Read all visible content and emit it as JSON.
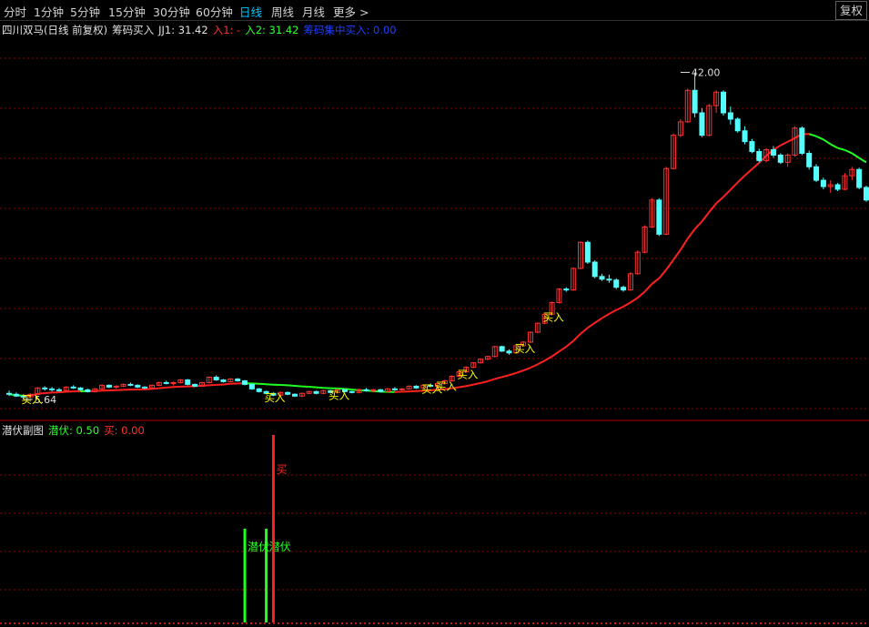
{
  "toolbar": {
    "timeframes": [
      "分时",
      "1分钟",
      "5分钟",
      "15分钟",
      "30分钟",
      "60分钟",
      "日线",
      "周线",
      "月线",
      "更多 >"
    ],
    "active": "日线",
    "fq_label": "复权"
  },
  "main_panel": {
    "stock_title": "四川双马(日线 前复权)",
    "indicator_name": "筹码买入",
    "jj1": "JJ1: 31.42",
    "in1": "入1: -",
    "in2": "入2: 31.42",
    "chip": "筹码集中买入: 0.00"
  },
  "sub_panel": {
    "title": "潜伏副图",
    "qianfu": "潜伏: 0.50",
    "mai": "买: 0.00"
  },
  "colors": {
    "up": "#ff3232",
    "down": "#54ffff",
    "ma_up": "#ff2020",
    "ma_down": "#20ff20",
    "signal_text": "#ffff00",
    "grid": "#8b0000",
    "active_tab": "#00c8ff"
  },
  "chart_data": [
    {
      "type": "candlestick",
      "name": "main",
      "ylim": [
        4.0,
        46.0
      ],
      "max_label": "42.00",
      "min_label": "5.64",
      "max_index": 94,
      "min_index": 2,
      "candles": [
        [
          6.3,
          6.6,
          6.0,
          6.2
        ],
        [
          6.2,
          6.4,
          5.9,
          6.0
        ],
        [
          6.0,
          6.2,
          5.64,
          5.9
        ],
        [
          5.9,
          6.3,
          5.8,
          6.2
        ],
        [
          6.2,
          7.0,
          6.1,
          6.9
        ],
        [
          6.9,
          7.1,
          6.6,
          6.8
        ],
        [
          6.8,
          7.0,
          6.5,
          6.7
        ],
        [
          6.7,
          6.9,
          6.5,
          6.6
        ],
        [
          6.6,
          7.1,
          6.5,
          7.0
        ],
        [
          7.0,
          7.2,
          6.8,
          6.9
        ],
        [
          6.9,
          7.0,
          6.6,
          6.7
        ],
        [
          6.7,
          6.8,
          6.4,
          6.5
        ],
        [
          6.5,
          6.9,
          6.4,
          6.8
        ],
        [
          6.8,
          7.3,
          6.7,
          7.2
        ],
        [
          7.2,
          7.3,
          6.9,
          7.0
        ],
        [
          7.0,
          7.2,
          6.8,
          7.1
        ],
        [
          7.1,
          7.4,
          7.0,
          7.3
        ],
        [
          7.3,
          7.5,
          7.1,
          7.2
        ],
        [
          7.2,
          7.3,
          6.9,
          7.0
        ],
        [
          7.0,
          7.1,
          6.8,
          6.9
        ],
        [
          6.9,
          7.3,
          6.8,
          7.2
        ],
        [
          7.2,
          7.6,
          7.1,
          7.5
        ],
        [
          7.5,
          7.7,
          7.3,
          7.4
        ],
        [
          7.4,
          7.6,
          7.2,
          7.5
        ],
        [
          7.5,
          7.9,
          7.4,
          7.8
        ],
        [
          7.8,
          7.9,
          7.2,
          7.3
        ],
        [
          7.3,
          7.4,
          7.0,
          7.1
        ],
        [
          7.1,
          7.6,
          7.0,
          7.5
        ],
        [
          7.5,
          8.2,
          7.4,
          8.1
        ],
        [
          8.1,
          8.3,
          7.7,
          7.8
        ],
        [
          7.8,
          7.9,
          7.5,
          7.6
        ],
        [
          7.6,
          8.0,
          7.5,
          7.9
        ],
        [
          7.9,
          8.0,
          7.6,
          7.7
        ],
        [
          7.7,
          7.8,
          7.2,
          7.3
        ],
        [
          7.3,
          7.4,
          6.7,
          6.8
        ],
        [
          6.8,
          6.9,
          6.4,
          6.5
        ],
        [
          6.5,
          6.6,
          6.2,
          6.3
        ],
        [
          6.3,
          6.4,
          6.0,
          6.1
        ],
        [
          6.1,
          6.5,
          6.0,
          6.4
        ],
        [
          6.4,
          6.5,
          6.1,
          6.2
        ],
        [
          6.2,
          6.3,
          5.9,
          6.0
        ],
        [
          6.0,
          6.4,
          5.9,
          6.3
        ],
        [
          6.3,
          6.6,
          6.2,
          6.5
        ],
        [
          6.5,
          6.6,
          6.2,
          6.3
        ],
        [
          6.3,
          6.7,
          6.2,
          6.6
        ],
        [
          6.6,
          6.7,
          6.3,
          6.4
        ],
        [
          6.4,
          6.8,
          6.3,
          6.7
        ],
        [
          6.7,
          6.8,
          6.4,
          6.5
        ],
        [
          6.5,
          6.6,
          6.3,
          6.4
        ],
        [
          6.4,
          6.8,
          6.3,
          6.7
        ],
        [
          6.7,
          6.9,
          6.5,
          6.6
        ],
        [
          6.6,
          6.8,
          6.4,
          6.7
        ],
        [
          6.7,
          6.8,
          6.4,
          6.5
        ],
        [
          6.5,
          6.9,
          6.4,
          6.8
        ],
        [
          6.8,
          7.0,
          6.6,
          6.7
        ],
        [
          6.7,
          6.9,
          6.5,
          6.8
        ],
        [
          6.8,
          7.2,
          6.7,
          7.1
        ],
        [
          7.1,
          7.2,
          6.8,
          6.9
        ],
        [
          6.9,
          7.3,
          6.8,
          7.2
        ],
        [
          7.2,
          7.4,
          7.0,
          7.1
        ],
        [
          7.1,
          7.5,
          7.0,
          7.4
        ],
        [
          7.4,
          7.8,
          7.3,
          7.7
        ],
        [
          7.7,
          8.3,
          7.6,
          8.2
        ],
        [
          8.2,
          8.8,
          8.1,
          8.7
        ],
        [
          8.7,
          9.3,
          8.6,
          9.2
        ],
        [
          9.2,
          9.8,
          9.1,
          9.7
        ],
        [
          9.7,
          10.2,
          9.6,
          10.1
        ],
        [
          10.1,
          10.5,
          10.0,
          10.4
        ],
        [
          10.4,
          11.6,
          10.3,
          11.5
        ],
        [
          11.5,
          11.6,
          10.9,
          11.0
        ],
        [
          11.0,
          11.2,
          10.6,
          10.8
        ],
        [
          10.8,
          11.7,
          10.7,
          11.6
        ],
        [
          11.6,
          12.1,
          11.5,
          12.0
        ],
        [
          12.0,
          13.2,
          11.9,
          13.1
        ],
        [
          13.1,
          14.2,
          13.0,
          14.1
        ],
        [
          14.1,
          15.2,
          14.0,
          15.1
        ],
        [
          15.1,
          16.5,
          15.0,
          16.4
        ],
        [
          16.4,
          18.0,
          16.3,
          17.9
        ],
        [
          17.9,
          18.1,
          17.6,
          17.8
        ],
        [
          17.8,
          20.3,
          17.7,
          20.2
        ],
        [
          20.2,
          23.2,
          20.1,
          23.1
        ],
        [
          23.1,
          23.3,
          20.7,
          20.9
        ],
        [
          20.9,
          21.1,
          19.1,
          19.3
        ],
        [
          19.3,
          19.6,
          18.8,
          19.0
        ],
        [
          19.0,
          19.5,
          18.6,
          18.9
        ],
        [
          18.9,
          19.1,
          17.9,
          18.1
        ],
        [
          18.1,
          18.3,
          17.6,
          17.8
        ],
        [
          17.8,
          19.8,
          17.7,
          19.6
        ],
        [
          19.6,
          22.2,
          19.5,
          22.0
        ],
        [
          22.0,
          25.0,
          21.9,
          24.8
        ],
        [
          24.8,
          28.0,
          24.7,
          27.8
        ],
        [
          27.8,
          28.0,
          23.8,
          24.0
        ],
        [
          24.0,
          31.5,
          23.9,
          31.3
        ],
        [
          31.3,
          35.2,
          31.2,
          35.0
        ],
        [
          35.0,
          36.8,
          34.8,
          36.5
        ],
        [
          36.5,
          40.2,
          36.4,
          40.0
        ],
        [
          40.0,
          42.0,
          37.0,
          37.5
        ],
        [
          37.5,
          38.0,
          34.8,
          35.0
        ],
        [
          35.0,
          38.5,
          34.9,
          38.3
        ],
        [
          38.3,
          40.0,
          37.5,
          39.8
        ],
        [
          39.8,
          40.0,
          37.2,
          37.5
        ],
        [
          37.5,
          38.2,
          36.2,
          36.8
        ],
        [
          36.8,
          37.0,
          35.3,
          35.5
        ],
        [
          35.5,
          36.0,
          34.0,
          34.3
        ],
        [
          34.3,
          34.6,
          33.0,
          33.2
        ],
        [
          33.2,
          33.5,
          32.0,
          32.2
        ],
        [
          32.2,
          33.6,
          32.0,
          33.4
        ],
        [
          33.4,
          33.8,
          32.5,
          32.8
        ],
        [
          32.8,
          33.0,
          31.8,
          32.0
        ],
        [
          32.0,
          33.0,
          31.5,
          32.8
        ],
        [
          32.8,
          36.0,
          32.6,
          35.8
        ],
        [
          35.8,
          36.0,
          32.8,
          33.0
        ],
        [
          33.0,
          33.3,
          31.2,
          31.5
        ],
        [
          31.5,
          31.8,
          29.8,
          30.0
        ],
        [
          30.0,
          30.3,
          29.0,
          29.3
        ],
        [
          29.3,
          30.0,
          28.6,
          29.5
        ],
        [
          29.5,
          29.7,
          28.8,
          29.0
        ],
        [
          29.0,
          30.8,
          28.9,
          30.5
        ],
        [
          30.5,
          31.5,
          30.0,
          31.2
        ],
        [
          31.2,
          31.4,
          29.0,
          29.2
        ],
        [
          29.2,
          29.4,
          27.6,
          27.8
        ]
      ],
      "signals": [
        {
          "index": 3,
          "label": "买入"
        },
        {
          "index": 37,
          "label": "买入"
        },
        {
          "index": 46,
          "label": "买入"
        },
        {
          "index": 59,
          "label": "买入"
        },
        {
          "index": 61,
          "label": "买入"
        },
        {
          "index": 64,
          "label": "买入"
        },
        {
          "index": 72,
          "label": "买入"
        },
        {
          "index": 76,
          "label": "买入"
        }
      ]
    },
    {
      "type": "bar",
      "name": "sub",
      "ylim": [
        0,
        1.0
      ],
      "bars": [
        {
          "index": 33,
          "value": 0.5,
          "label": "潜伏",
          "color": "#20ff20"
        },
        {
          "index": 36,
          "value": 0.5,
          "label": "潜伏",
          "color": "#20ff20"
        },
        {
          "index": 37,
          "value": 1.0,
          "label": "买",
          "color": "#ff2020"
        }
      ]
    }
  ]
}
